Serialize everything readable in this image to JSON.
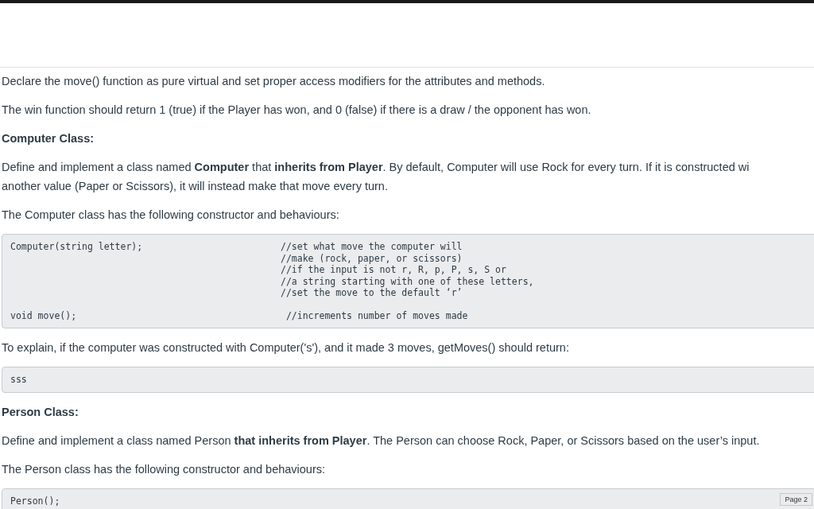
{
  "content": [
    {
      "kind": "paragraph",
      "lines": [
        "Declare the move() function as pure virtual and set proper access modifiers for the attributes and methods."
      ]
    },
    {
      "kind": "paragraph",
      "lines": [
        "The win function should return 1 (true) if the Player has won, and 0 (false) if there is a draw / the opponent has won."
      ]
    },
    {
      "kind": "heading",
      "lines": [
        "Computer Class:"
      ]
    },
    {
      "kind": "paragraph",
      "lines": [
        "Define and implement a class named **Computer** that **inherits from Player**. By default, Computer will use Rock for every turn. If it is constructed wi",
        "another value (Paper or Scissors), it will instead make that move every turn."
      ]
    },
    {
      "kind": "paragraph",
      "lines": [
        "The Computer class has the following constructor and behaviours:"
      ]
    },
    {
      "kind": "code",
      "rows": [
        {
          "code": "Computer(string letter);",
          "comment": [
            "//set what move the computer will",
            "//make (rock, paper, or scissors)",
            "//if the input is not r, R, p, P, s, S or",
            "//a string starting with one of these letters,",
            "//set the move to the default ‘r’"
          ]
        },
        {
          "code": "void move();",
          "comment": [
            " //increments number of moves made"
          ]
        }
      ]
    },
    {
      "kind": "paragraph",
      "lines": [
        "To explain, if the computer was constructed with Computer('s'), and it made 3 moves, getMoves() should return:"
      ]
    },
    {
      "kind": "code",
      "rows": [
        {
          "code": "sss"
        }
      ]
    },
    {
      "kind": "heading",
      "lines": [
        "Person Class:"
      ]
    },
    {
      "kind": "paragraph",
      "lines": [
        "Define and implement a class named Person **that inherits from Player**. The Person can choose Rock, Paper, or Scissors based on the user’s input."
      ]
    },
    {
      "kind": "paragraph",
      "lines": [
        "The Person class has the following constructor and behaviours:"
      ]
    },
    {
      "kind": "code",
      "rows": [
        {
          "code": "Person();"
        }
      ]
    }
  ],
  "page_label": "Page 2"
}
